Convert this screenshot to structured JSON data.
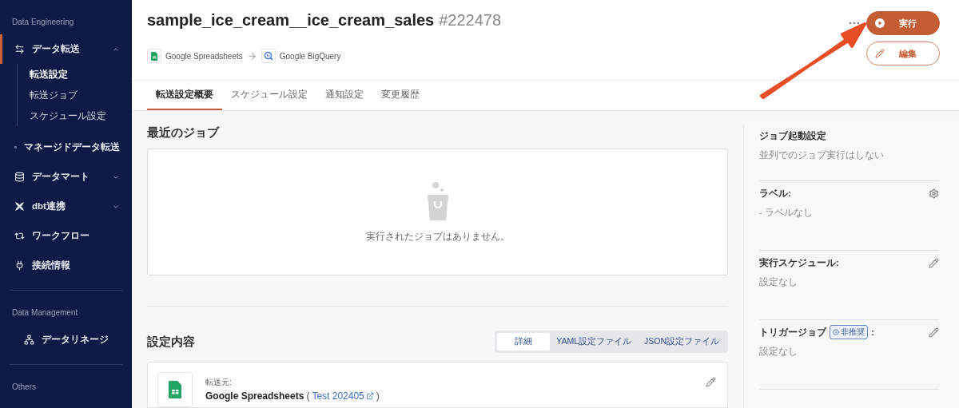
{
  "sidebar": {
    "sections": [
      {
        "title": "Data Engineering",
        "items": [
          {
            "label": "データ転送",
            "selected": true,
            "expanded": true,
            "children": [
              {
                "label": "転送設定",
                "selected": true
              },
              {
                "label": "転送ジョブ",
                "selected": false
              },
              {
                "label": "スケジュール設定",
                "selected": false
              }
            ]
          },
          {
            "label": "マネージドデータ転送",
            "selected": false
          },
          {
            "label": "データマート",
            "selected": false,
            "expanded": false
          },
          {
            "label": "dbt連携",
            "selected": false,
            "expanded": false
          },
          {
            "label": "ワークフロー",
            "selected": false
          },
          {
            "label": "接続情報",
            "selected": false
          }
        ]
      },
      {
        "title": "Data Management",
        "items": [
          {
            "label": "データリネージ",
            "selected": false
          }
        ]
      },
      {
        "title": "Others"
      }
    ]
  },
  "header": {
    "title": "sample_ice_cream__ice_cream_sales",
    "id": "#222478",
    "source": "Google Spreadsheets",
    "destination": "Google BigQuery",
    "buttons": [
      {
        "label": "実行",
        "kind": "primary"
      },
      {
        "label": "編集",
        "kind": "outline"
      }
    ]
  },
  "tabs": [
    {
      "label": "転送設定概要",
      "selected": true
    },
    {
      "label": "スケジュール設定",
      "selected": false
    },
    {
      "label": "通知設定",
      "selected": false
    },
    {
      "label": "変更履歴",
      "selected": false
    }
  ],
  "recent_jobs": {
    "heading": "最近のジョブ",
    "empty_message": "実行されたジョブはありません。"
  },
  "settings": {
    "heading": "設定内容",
    "views": [
      {
        "label": "詳細",
        "selected": true
      },
      {
        "label": "YAML設定ファイル",
        "selected": false
      },
      {
        "label": "JSON設定ファイル",
        "selected": false
      }
    ],
    "source_label": "転送元:",
    "source_name": "Google Spreadsheets",
    "link_open": "(",
    "link": "Test 202405",
    "link_close": ")"
  },
  "side_panel": [
    {
      "title": "ジョブ起動設定",
      "value": "並列でのジョブ実行はしない",
      "kind": "plain"
    },
    {
      "title": "ラベル:",
      "value": "- ラベルなし",
      "kind": "gear"
    },
    {
      "title": "実行スケジュール:",
      "value": "設定なし",
      "kind": "edit"
    },
    {
      "title": "トリガージョブ",
      "badge": "非推奨",
      "suffix": ":",
      "value": "設定なし",
      "kind": "edit"
    }
  ]
}
